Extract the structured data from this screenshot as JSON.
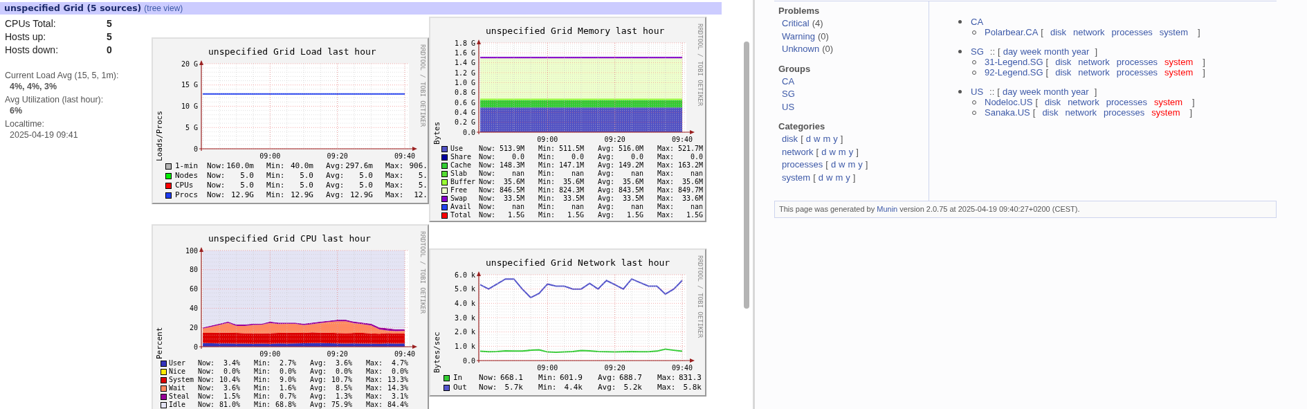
{
  "header": {
    "title": "unspecified Grid (5 sources)",
    "link": "(tree view)"
  },
  "summary": [
    {
      "label": "CPUs Total:",
      "value": "5"
    },
    {
      "label": "Hosts up:",
      "value": "5"
    },
    {
      "label": "Hosts down:",
      "value": "0"
    }
  ],
  "details": [
    {
      "label": "Current Load Avg (15, 5, 1m):",
      "value": "4%, 4%, 3%",
      "bold": true
    },
    {
      "label": "Avg Utilization (last hour):",
      "value": "6%",
      "bold": true
    },
    {
      "label": "Localtime:",
      "value": "2025-04-19 09:41",
      "bold": false
    }
  ],
  "graphs": [
    {
      "credit": "RRDTOOL / TOBI OETIKER",
      "legend": [
        {
          "stats": [
            {
              "label": "Now:",
              "value": "160.0m"
            },
            {
              "label": "Min:",
              "value": "40.0m"
            },
            {
              "label": "Avg:",
              "value": "297.6m"
            },
            {
              "label": "Max:",
              "value": "906."
            }
          ]
        },
        {
          "stats": [
            {
              "label": "Now:",
              "value": "5.0"
            },
            {
              "label": "Min:",
              "value": "5.0"
            },
            {
              "label": "Avg:",
              "value": "5.0"
            },
            {
              "label": "Max:",
              "value": "5."
            }
          ]
        },
        {
          "stats": [
            {
              "label": "Now:",
              "value": "5.0"
            },
            {
              "label": "Min:",
              "value": "5.0"
            },
            {
              "label": "Avg:",
              "value": "5.0"
            },
            {
              "label": "Max:",
              "value": "5."
            }
          ]
        },
        {
          "stats": [
            {
              "label": "Now:",
              "value": "12.9G"
            },
            {
              "label": "Min:",
              "value": "12.9G"
            },
            {
              "label": "Avg:",
              "value": "12.9G"
            },
            {
              "label": "Max:",
              "value": "12."
            }
          ]
        }
      ],
      "chart_data": {
        "type": "line",
        "grid": true,
        "title": "unspecified Grid Load last hour",
        "ylabel": "Loads/Procs",
        "categories": [
          null,
          null,
          null,
          null,
          null,
          null,
          null,
          null,
          "09:00",
          null,
          null,
          null,
          null,
          null,
          null,
          null,
          "09:20",
          null,
          null,
          null,
          null,
          null,
          null,
          null,
          "09:40"
        ],
        "ylim": [
          0,
          20
        ],
        "yticks": [
          {
            "value": 0,
            "label": "0"
          },
          {
            "value": 5,
            "label": "5 G"
          },
          {
            "value": 10,
            "label": "10 G"
          },
          {
            "value": 15,
            "label": "15 G"
          },
          {
            "value": 20,
            "label": "20 G"
          }
        ],
        "series": [
          {
            "name": "1-min",
            "color": "#b4b4b4",
            "values": [
              null,
              null,
              null,
              null,
              null,
              null,
              null,
              null,
              null,
              null,
              null,
              null,
              null,
              null,
              null,
              null,
              null,
              null,
              null,
              null,
              null,
              null,
              null,
              null,
              null
            ]
          },
          {
            "name": "Nodes",
            "color": "#00ee00",
            "values": [
              null,
              null,
              null,
              null,
              null,
              null,
              null,
              null,
              null,
              null,
              null,
              null,
              null,
              null,
              null,
              null,
              null,
              null,
              null,
              null,
              null,
              null,
              null,
              null,
              null
            ]
          },
          {
            "name": "CPUs",
            "color": "#ff0000",
            "values": [
              null,
              null,
              null,
              null,
              null,
              null,
              null,
              null,
              null,
              null,
              null,
              null,
              null,
              null,
              null,
              null,
              null,
              null,
              null,
              null,
              null,
              null,
              null,
              null,
              null
            ]
          },
          {
            "name": "Procs",
            "color": "#1f3cf0",
            "values": [
              12.9,
              12.9,
              12.9,
              12.9,
              12.9,
              12.9,
              12.9,
              12.9,
              12.9,
              12.9,
              12.9,
              12.9,
              12.9,
              12.9,
              12.9,
              12.9,
              12.9,
              12.9,
              12.9,
              12.9,
              12.9,
              12.9,
              12.9,
              12.9,
              12.9
            ]
          }
        ]
      }
    },
    {
      "credit": "RRDTOOL / TOBI OETIKER",
      "legend": [
        {
          "stats": [
            {
              "label": "Now:",
              "value": "513.9M"
            },
            {
              "label": "Min:",
              "value": "511.5M"
            },
            {
              "label": "Avg:",
              "value": "516.0M"
            },
            {
              "label": "Max:",
              "value": "521.7M"
            }
          ]
        },
        {
          "stats": [
            {
              "label": "Now:",
              "value": "0.0"
            },
            {
              "label": "Min:",
              "value": "0.0"
            },
            {
              "label": "Avg:",
              "value": "0.0"
            },
            {
              "label": "Max:",
              "value": "0.0"
            }
          ]
        },
        {
          "stats": [
            {
              "label": "Now:",
              "value": "148.3M"
            },
            {
              "label": "Min:",
              "value": "147.1M"
            },
            {
              "label": "Avg:",
              "value": "149.2M"
            },
            {
              "label": "Max:",
              "value": "163.2M"
            }
          ]
        },
        {
          "stats": [
            {
              "label": "Now:",
              "value": "nan"
            },
            {
              "label": "Min:",
              "value": "nan"
            },
            {
              "label": "Avg:",
              "value": "nan"
            },
            {
              "label": "Max:",
              "value": "nan"
            }
          ]
        },
        {
          "stats": [
            {
              "label": "Now:",
              "value": "35.6M"
            },
            {
              "label": "Min:",
              "value": "35.6M"
            },
            {
              "label": "Avg:",
              "value": "35.6M"
            },
            {
              "label": "Max:",
              "value": "35.6M"
            }
          ]
        },
        {
          "stats": [
            {
              "label": "Now:",
              "value": "846.5M"
            },
            {
              "label": "Min:",
              "value": "824.3M"
            },
            {
              "label": "Avg:",
              "value": "843.5M"
            },
            {
              "label": "Max:",
              "value": "849.7M"
            }
          ]
        },
        {
          "stats": [
            {
              "label": "Now:",
              "value": "33.5M"
            },
            {
              "label": "Min:",
              "value": "33.5M"
            },
            {
              "label": "Avg:",
              "value": "33.5M"
            },
            {
              "label": "Max:",
              "value": "33.6M"
            }
          ]
        },
        {
          "stats": [
            {
              "label": "Now:",
              "value": "nan"
            },
            {
              "label": "Min:",
              "value": "nan"
            },
            {
              "label": "Avg:",
              "value": "nan"
            },
            {
              "label": "Max:",
              "value": "nan"
            }
          ]
        },
        {
          "name": "Total",
          "color": "#ff0000",
          "stats": [
            {
              "label": "Now:",
              "value": "1.5G"
            },
            {
              "label": "Min:",
              "value": "1.5G"
            },
            {
              "label": "Avg:",
              "value": "1.5G"
            },
            {
              "label": "Max:",
              "value": "1.5G"
            }
          ]
        }
      ],
      "chart_data": {
        "type": "area",
        "stacked": true,
        "grid": true,
        "title": "unspecified Grid Memory last hour",
        "ylabel": "Bytes",
        "categories": [
          null,
          null,
          null,
          null,
          null,
          null,
          null,
          null,
          "09:00",
          null,
          null,
          null,
          null,
          null,
          null,
          null,
          "09:20",
          null,
          null,
          null,
          null,
          null,
          null,
          null,
          "09:40"
        ],
        "ylim": [
          0,
          1.8
        ],
        "yticks": [
          {
            "value": 0,
            "label": "0.0"
          },
          {
            "value": 0.2,
            "label": "0.2 G"
          },
          {
            "value": 0.4,
            "label": "0.4 G"
          },
          {
            "value": 0.6,
            "label": "0.6 G"
          },
          {
            "value": 0.8,
            "label": "0.8 G"
          },
          {
            "value": 1.0,
            "label": "1.0 G"
          },
          {
            "value": 1.2,
            "label": "1.2 G"
          },
          {
            "value": 1.4,
            "label": "1.4 G"
          },
          {
            "value": 1.6,
            "label": "1.6 G"
          },
          {
            "value": 1.8,
            "label": "1.8 G"
          }
        ],
        "series": [
          {
            "name": "Use",
            "color": "#5252c4",
            "values": [
              0.5,
              0.5,
              0.5,
              0.5,
              0.5,
              0.5,
              0.5,
              0.5,
              0.5,
              0.5,
              0.5,
              0.5,
              0.5,
              0.5,
              0.5,
              0.5,
              0.5,
              0.5,
              0.5,
              0.5,
              0.5,
              0.5,
              0.5,
              0.5,
              0.5
            ]
          },
          {
            "name": "Share",
            "color": "#0000a0",
            "values": [
              null,
              null,
              null,
              null,
              null,
              null,
              null,
              null,
              null,
              null,
              null,
              null,
              null,
              null,
              null,
              null,
              null,
              null,
              null,
              null,
              null,
              null,
              null,
              null,
              null
            ]
          },
          {
            "name": "Cache",
            "color": "#33cc33",
            "values": [
              0.15,
              0.15,
              0.15,
              0.15,
              0.15,
              0.15,
              0.15,
              0.15,
              0.15,
              0.15,
              0.15,
              0.15,
              0.15,
              0.15,
              0.15,
              0.15,
              0.15,
              0.15,
              0.15,
              0.15,
              0.15,
              0.15,
              0.15,
              0.15,
              0.15
            ]
          },
          {
            "name": "Slab",
            "color": "#55dd33",
            "values": [
              null,
              null,
              null,
              null,
              null,
              null,
              null,
              null,
              null,
              null,
              null,
              null,
              null,
              null,
              null,
              null,
              null,
              null,
              null,
              null,
              null,
              null,
              null,
              null,
              null
            ]
          },
          {
            "name": "Buffer",
            "color": "#99ff33",
            "values": [
              0.03,
              0.03,
              0.03,
              0.03,
              0.03,
              0.03,
              0.03,
              0.03,
              0.03,
              0.03,
              0.03,
              0.03,
              0.03,
              0.03,
              0.03,
              0.03,
              0.03,
              0.03,
              0.03,
              0.03,
              0.03,
              0.03,
              0.03,
              0.03,
              0.03
            ]
          },
          {
            "name": "Free",
            "color": "#eeffcc",
            "values": [
              0.81,
              0.81,
              0.81,
              0.81,
              0.81,
              0.81,
              0.81,
              0.81,
              0.81,
              0.81,
              0.81,
              0.81,
              0.81,
              0.81,
              0.81,
              0.81,
              0.81,
              0.81,
              0.81,
              0.81,
              0.81,
              0.81,
              0.81,
              0.81,
              0.81
            ]
          },
          {
            "name": "Swap",
            "color": "#8800cc",
            "values": [
              0.03,
              0.03,
              0.03,
              0.03,
              0.03,
              0.03,
              0.03,
              0.03,
              0.03,
              0.03,
              0.03,
              0.03,
              0.03,
              0.03,
              0.03,
              0.03,
              0.03,
              0.03,
              0.03,
              0.03,
              0.03,
              0.03,
              0.03,
              0.03,
              0.03
            ]
          },
          {
            "name": "Avail",
            "color": "#2244ee",
            "values": [
              null,
              null,
              null,
              null,
              null,
              null,
              null,
              null,
              null,
              null,
              null,
              null,
              null,
              null,
              null,
              null,
              null,
              null,
              null,
              null,
              null,
              null,
              null,
              null,
              null
            ]
          }
        ]
      }
    },
    {
      "credit": "RRDTOOL / TOBI OETIKER",
      "legend": [
        {
          "stats": [
            {
              "label": "Now:",
              "value": "3.4%"
            },
            {
              "label": "Min:",
              "value": "2.7%"
            },
            {
              "label": "Avg:",
              "value": "3.6%"
            },
            {
              "label": "Max:",
              "value": "4.7%"
            }
          ]
        },
        {
          "stats": [
            {
              "label": "Now:",
              "value": "0.0%"
            },
            {
              "label": "Min:",
              "value": "0.0%"
            },
            {
              "label": "Avg:",
              "value": "0.0%"
            },
            {
              "label": "Max:",
              "value": "0.0%"
            }
          ]
        },
        {
          "stats": [
            {
              "label": "Now:",
              "value": "10.4%"
            },
            {
              "label": "Min:",
              "value": "9.0%"
            },
            {
              "label": "Avg:",
              "value": "10.7%"
            },
            {
              "label": "Max:",
              "value": "13.3%"
            }
          ]
        },
        {
          "stats": [
            {
              "label": "Now:",
              "value": "3.6%"
            },
            {
              "label": "Min:",
              "value": "1.6%"
            },
            {
              "label": "Avg:",
              "value": "8.5%"
            },
            {
              "label": "Max:",
              "value": "14.3%"
            }
          ]
        },
        {
          "stats": [
            {
              "label": "Now:",
              "value": "1.5%"
            },
            {
              "label": "Min:",
              "value": "0.7%"
            },
            {
              "label": "Avg:",
              "value": "1.3%"
            },
            {
              "label": "Max:",
              "value": "3.1%"
            }
          ]
        },
        {
          "stats": [
            {
              "label": "Now:",
              "value": "81.0%"
            },
            {
              "label": "Min:",
              "value": "68.8%"
            },
            {
              "label": "Avg:",
              "value": "75.9%"
            },
            {
              "label": "Max:",
              "value": "84.4%"
            }
          ]
        }
      ],
      "chart_data": {
        "type": "area",
        "stacked": true,
        "grid": true,
        "title": "unspecified Grid CPU last hour",
        "ylabel": "Percent",
        "categories": [
          null,
          null,
          null,
          null,
          null,
          null,
          null,
          null,
          "09:00",
          null,
          null,
          null,
          null,
          null,
          null,
          null,
          "09:20",
          null,
          null,
          null,
          null,
          null,
          null,
          null,
          "09:40"
        ],
        "ylim": [
          0,
          100
        ],
        "yticks": [
          {
            "value": 0,
            "label": "0"
          },
          {
            "value": 20,
            "label": "20"
          },
          {
            "value": 40,
            "label": "40"
          },
          {
            "value": 60,
            "label": "60"
          },
          {
            "value": 80,
            "label": "80"
          },
          {
            "value": 100,
            "label": "100"
          }
        ],
        "series": [
          {
            "name": "User",
            "color": "#3333bb",
            "values": [
              3.8,
              3.6,
              3.5,
              3.4,
              3.3,
              3.2,
              3.0,
              3.2,
              3.0,
              3.4,
              3.3,
              3.5,
              3.6,
              3.8,
              3.7,
              3.6,
              3.5,
              3.3,
              3.4,
              3.3,
              3.2,
              3.1,
              3.4,
              3.2,
              3.4
            ]
          },
          {
            "name": "Nice",
            "color": "#ffea00",
            "values": [
              null,
              null,
              null,
              null,
              null,
              null,
              null,
              null,
              null,
              null,
              null,
              null,
              null,
              null,
              null,
              null,
              null,
              null,
              null,
              null,
              null,
              null,
              null,
              null,
              null
            ]
          },
          {
            "name": "System",
            "color": "#dd0000",
            "values": [
              10.5,
              10.8,
              11,
              11.2,
              11,
              10.8,
              11,
              10.6,
              11,
              10.9,
              11.2,
              11,
              10.8,
              11.1,
              10.9,
              11,
              10.7,
              10.8,
              10.9,
              11,
              10.6,
              10.4,
              10.8,
              10.5,
              10.4
            ]
          },
          {
            "name": "Wait",
            "color": "#ff8a60",
            "values": [
              4.5,
              6.3,
              8.2,
              10.2,
              7.3,
              7.5,
              8.7,
              9.0,
              10.7,
              9.3,
              9.2,
              9.3,
              8.1,
              8.5,
              10.0,
              11.1,
              12.3,
              12.3,
              10.2,
              9.1,
              8.4,
              4.5,
              2.6,
              2.5,
              2.7
            ]
          },
          {
            "name": "Steal",
            "color": "#990099",
            "values": [
              1.2,
              1.3,
              1.3,
              1.2,
              1.4,
              1.5,
              1.3,
              1.2,
              1.3,
              1.4,
              1.3,
              1.2,
              1.5,
              1.6,
              1.4,
              1.3,
              1.5,
              1.6,
              1.5,
              1.6,
              1.8,
              2.0,
              2.2,
              1.8,
              1.5
            ]
          },
          {
            "name": "Idle",
            "color": "#e4e4f4",
            "values": [
              80,
              78,
              76,
              74,
              77,
              77,
              76,
              76,
              74,
              75,
              75,
              75,
              76,
              75,
              74,
              73,
              72,
              72,
              74,
              75,
              76,
              80,
              81,
              82,
              82
            ]
          }
        ]
      }
    },
    {
      "credit": "RRDTOOL / TOBI OETIKER",
      "legend": [
        {
          "stats": [
            {
              "label": "Now:",
              "value": "668.1"
            },
            {
              "label": "Min:",
              "value": "601.9"
            },
            {
              "label": "Avg:",
              "value": "688.7"
            },
            {
              "label": "Max:",
              "value": "831.3"
            }
          ]
        },
        {
          "stats": [
            {
              "label": "Now:",
              "value": "5.7k"
            },
            {
              "label": "Min:",
              "value": "4.4k"
            },
            {
              "label": "Avg:",
              "value": "5.2k"
            },
            {
              "label": "Max:",
              "value": "5.8k"
            }
          ]
        }
      ],
      "chart_data": {
        "type": "line",
        "grid": true,
        "title": "unspecified Grid Network last hour",
        "ylabel": "Bytes/sec",
        "categories": [
          null,
          null,
          null,
          null,
          null,
          null,
          null,
          null,
          "09:00",
          null,
          null,
          null,
          null,
          null,
          null,
          null,
          "09:20",
          null,
          null,
          null,
          null,
          null,
          null,
          null,
          "09:40"
        ],
        "ylim": [
          0,
          6
        ],
        "yticks": [
          {
            "value": 0,
            "label": "0.0"
          },
          {
            "value": 1,
            "label": "1.0 k"
          },
          {
            "value": 2,
            "label": "2.0 k"
          },
          {
            "value": 3,
            "label": "3.0 k"
          },
          {
            "value": 4,
            "label": "4.0 k"
          },
          {
            "value": 5,
            "label": "5.0 k"
          },
          {
            "value": 6,
            "label": "6.0 k"
          }
        ],
        "series": [
          {
            "name": "In",
            "color": "#33cc33",
            "values": [
              0.65,
              0.62,
              0.63,
              0.68,
              0.66,
              0.66,
              0.72,
              0.75,
              0.6,
              0.58,
              0.6,
              0.63,
              0.7,
              0.68,
              0.63,
              0.62,
              0.61,
              0.62,
              0.63,
              0.62,
              0.62,
              0.66,
              0.8,
              0.72,
              0.65
            ]
          },
          {
            "name": "Out",
            "color": "#5555cc",
            "values": [
              5.3,
              5.0,
              5.35,
              5.7,
              5.7,
              5.0,
              4.4,
              4.7,
              5.35,
              5.2,
              5.2,
              5.0,
              5.0,
              5.4,
              5.0,
              5.6,
              5.3,
              5.0,
              5.7,
              5.45,
              5.2,
              5.2,
              4.65,
              5.0,
              5.6
            ]
          }
        ]
      }
    }
  ],
  "nav": [
    {
      "title": "Problems",
      "items": [
        {
          "label": "Critical",
          "count": "(4)"
        },
        {
          "label": "Warning",
          "count": "(0)"
        },
        {
          "label": "Unknown",
          "count": "(0)"
        }
      ]
    },
    {
      "title": "Groups",
      "items": [
        {
          "label": "CA"
        },
        {
          "label": "SG"
        },
        {
          "label": "US"
        }
      ]
    },
    {
      "title": "Categories",
      "items": [
        {
          "label": "disk",
          "open": "[",
          "periods": [
            "d",
            "w",
            "m",
            "y"
          ],
          "close": "]"
        },
        {
          "label": "network",
          "open": "[",
          "periods": [
            "d",
            "w",
            "m",
            "y"
          ],
          "close": "]"
        },
        {
          "label": "processes",
          "open": "[",
          "periods": [
            "d",
            "w",
            "m",
            "y"
          ],
          "close": "]"
        },
        {
          "label": "system",
          "open": "[",
          "periods": [
            "d",
            "w",
            "m",
            "y"
          ],
          "close": "]"
        }
      ]
    }
  ],
  "groups": [
    {
      "name": "CA",
      "hosts": [
        {
          "name": "Polarbear.CA",
          "open": "[",
          "close": "]",
          "categories": [
            {
              "name": "disk",
              "problem": false
            },
            {
              "name": "network",
              "problem": false
            },
            {
              "name": "processes",
              "problem": false
            },
            {
              "name": "system",
              "problem": false
            }
          ]
        }
      ]
    },
    {
      "name": "SG",
      "separator": "::",
      "open": "[",
      "periods": [
        "day",
        "week",
        "month",
        "year"
      ],
      "close": "]",
      "hosts": [
        {
          "name": "31-Legend.SG",
          "open": "[",
          "close": "]",
          "categories": [
            {
              "name": "disk",
              "problem": false
            },
            {
              "name": "network",
              "problem": false
            },
            {
              "name": "processes",
              "problem": false
            },
            {
              "name": "system",
              "problem": true
            }
          ]
        },
        {
          "name": "92-Legend.SG",
          "open": "[",
          "close": "]",
          "categories": [
            {
              "name": "disk",
              "problem": false
            },
            {
              "name": "network",
              "problem": false
            },
            {
              "name": "processes",
              "problem": false
            },
            {
              "name": "system",
              "problem": true
            }
          ]
        }
      ]
    },
    {
      "name": "US",
      "separator": "::",
      "open": "[",
      "periods": [
        "day",
        "week",
        "month",
        "year"
      ],
      "close": "]",
      "hosts": [
        {
          "name": "Nodeloc.US",
          "open": "[",
          "close": "]",
          "categories": [
            {
              "name": "disk",
              "problem": false
            },
            {
              "name": "network",
              "problem": false
            },
            {
              "name": "processes",
              "problem": false
            },
            {
              "name": "system",
              "problem": true
            }
          ]
        },
        {
          "name": "Sanaka.US",
          "open": "[",
          "close": "]",
          "categories": [
            {
              "name": "disk",
              "problem": false
            },
            {
              "name": "network",
              "problem": false
            },
            {
              "name": "processes",
              "problem": false
            },
            {
              "name": "system",
              "problem": true
            }
          ]
        }
      ]
    }
  ],
  "footer": {
    "before": "This page was generated by",
    "link": "Munin",
    "after": "version 2.0.75 at 2025-04-19 09:40:27+0200 (CEST)."
  }
}
